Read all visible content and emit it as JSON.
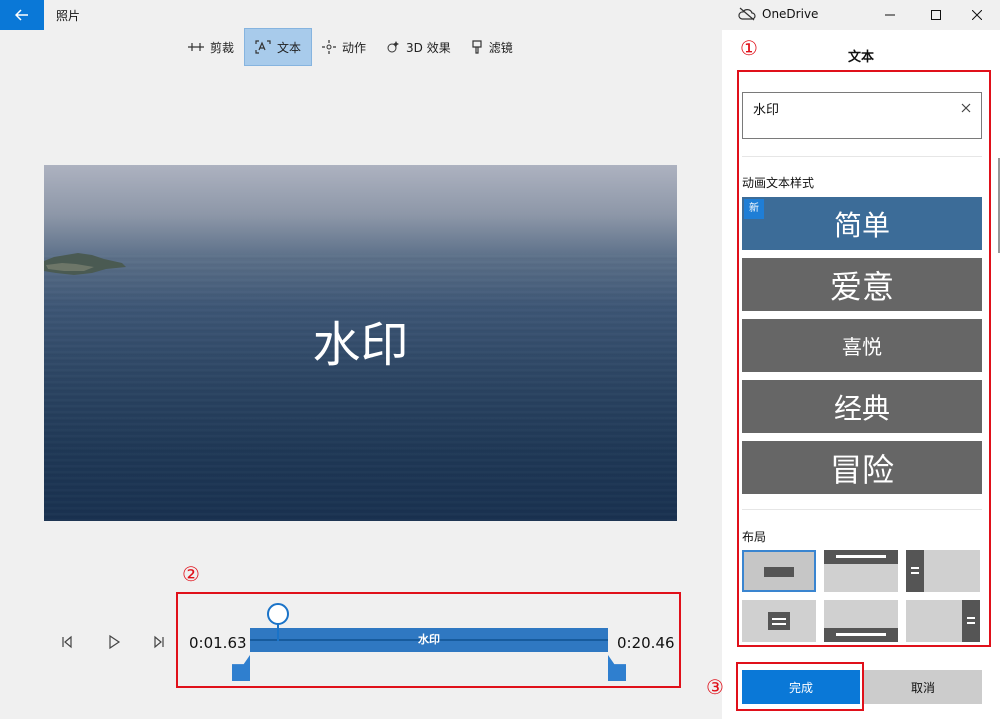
{
  "app": {
    "title": "照片",
    "cloud_label": "OneDrive"
  },
  "toolbar": [
    {
      "label": "剪裁",
      "icon": "trim-icon"
    },
    {
      "label": "文本",
      "icon": "text-icon",
      "active": true
    },
    {
      "label": "动作",
      "icon": "motion-icon"
    },
    {
      "label": "3D 效果",
      "icon": "3d-effects-icon"
    },
    {
      "label": "滤镜",
      "icon": "filter-icon"
    }
  ],
  "preview": {
    "overlay_text": "水印"
  },
  "timeline": {
    "start_time": "0:01.63",
    "end_time": "0:20.46",
    "clip_label": "水印"
  },
  "panel": {
    "title": "文本",
    "text_value": "水印",
    "animated_styles_label": "动画文本样式",
    "new_badge": "新",
    "styles": [
      "简单",
      "爱意",
      "喜悦",
      "经典",
      "冒险"
    ],
    "layout_label": "布局",
    "done_label": "完成",
    "cancel_label": "取消"
  },
  "annotations": {
    "a1": "①",
    "a2": "②",
    "a3": "③"
  },
  "colors": {
    "accent": "#0a78d7",
    "annotation": "#e0101a",
    "tile": "#666666",
    "tile_selected": "#3c6c98"
  }
}
